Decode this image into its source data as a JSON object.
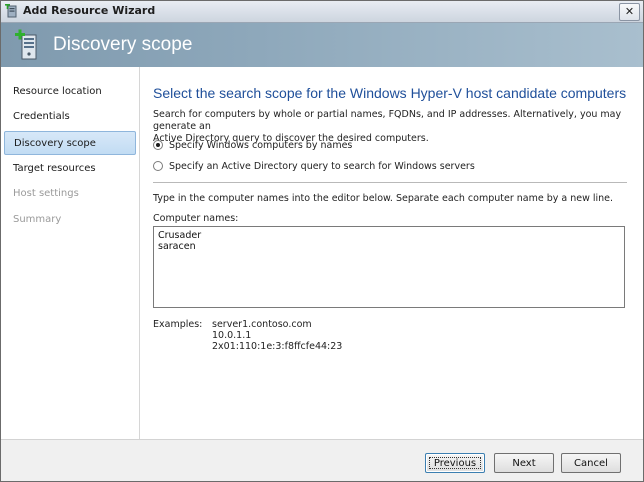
{
  "window": {
    "title": "Add Resource Wizard",
    "close_glyph": "✕"
  },
  "banner": {
    "title": "Discovery scope",
    "icon": "server-add-icon"
  },
  "nav": {
    "items": [
      {
        "label": "Resource location",
        "state": "normal"
      },
      {
        "label": "Credentials",
        "state": "normal"
      },
      {
        "label": "Discovery scope",
        "state": "selected"
      },
      {
        "label": "Target resources",
        "state": "normal"
      },
      {
        "label": "Host settings",
        "state": "disabled"
      },
      {
        "label": "Summary",
        "state": "disabled"
      }
    ]
  },
  "main": {
    "heading": "Select the search scope for the Windows Hyper-V host candidate computers",
    "description_line1": "Search for computers by whole or partial names, FQDNs, and IP addresses. Alternatively, you may generate an",
    "description_line2": "Active Directory query to discover the desired computers.",
    "options": [
      {
        "label": "Specify Windows computers by names",
        "selected": true
      },
      {
        "label": "Specify an Active Directory query to search for Windows servers",
        "selected": false
      }
    ],
    "instruction": "Type in the computer names into the editor below. Separate each computer name by a new line.",
    "names_label": "Computer names:",
    "names": [
      "Crusader",
      "saracen"
    ],
    "examples_label": "Examples:",
    "examples": [
      "server1.contoso.com",
      "10.0.1.1",
      "2x01:110:1e:3:f8ffcfe44:23"
    ]
  },
  "footer": {
    "previous_label": "Previous",
    "next_label": "Next",
    "cancel_label": "Cancel"
  },
  "colors": {
    "heading": "#1f4f9a",
    "banner": "#8ea8bb",
    "selected_nav": "#c2dcf3"
  }
}
